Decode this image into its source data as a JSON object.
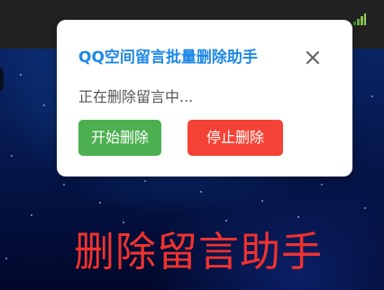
{
  "dialog": {
    "title": "QQ空间留言批量删除助手",
    "close_icon": "close-icon",
    "status": "正在删除留言中...",
    "start_label": "开始删除",
    "stop_label": "停止删除"
  },
  "background": {
    "headline": "删除留言助手"
  },
  "top_bar": {
    "signal_icon": "signal-icon"
  },
  "colors": {
    "title_blue": "#1e88e5",
    "start_green": "#4caf50",
    "stop_red": "#f44336",
    "headline_red": "#f0322e",
    "top_bar": "#222222"
  }
}
